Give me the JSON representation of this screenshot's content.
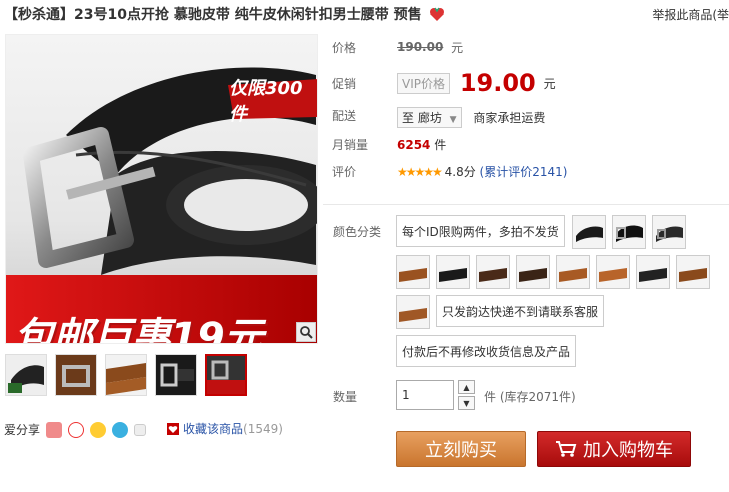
{
  "product": {
    "title": "【秒杀通】23号10点开抢 慕驰皮带 纯牛皮休闲针扣男士腰带 预售",
    "report_label": "举报此商品(举"
  },
  "gallery": {
    "badge_text": "仅限300件",
    "promo_text": "包邮巨惠19元",
    "thumb_count": 5,
    "active_thumb": 5
  },
  "share": {
    "label": "爱分享",
    "favorite_label": "收藏该商品",
    "favorite_count": "(1549)"
  },
  "info": {
    "price_label": "价格",
    "original_price": "190.00",
    "price_unit": "元",
    "promo_label": "促销",
    "vip_label": "VIP价格",
    "promo_price": "19.00",
    "shipping_label": "配送",
    "shipping_to": "至 廊坊",
    "shipping_note": "商家承担运费",
    "sales_label": "月销量",
    "sales_count": "6254",
    "sales_unit": "件",
    "rating_label": "评价",
    "stars": "★★★★★",
    "rating_score": "4.8分",
    "review_link": "(累计评价2141)"
  },
  "sku": {
    "color_label": "颜色分类",
    "text_options": [
      "每个ID限购两件，多拍不发货",
      "只发韵达快递不到请联系客服",
      "付款后不再修改收货信息及产品"
    ],
    "quantity_label": "数量",
    "quantity_value": "1",
    "stock_text": "件 (库存2071件)",
    "buy_now": "立刻购买",
    "add_to_cart": "加入购物车"
  },
  "colors": {
    "accent_red": "#c40000",
    "buy_orange": "#d98a45",
    "cart_red": "#b81414",
    "link_blue": "#2953a6"
  }
}
